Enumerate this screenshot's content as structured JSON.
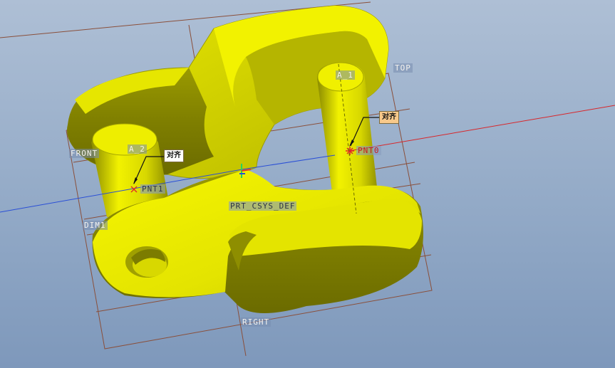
{
  "viewport": {
    "background_top": "#aebfd5",
    "background_bottom": "#7e98bb",
    "part_color": "#ecec00",
    "datum_color": "#8a4f3a"
  },
  "labels": {
    "front": "FRONT",
    "top": "TOP",
    "right": "RIGHT",
    "axis_a1": "A_1",
    "axis_a2": "A_2",
    "point_0": "PNT0",
    "point_1": "PNT1",
    "coord_sys": "PRT_CSYS_DEF",
    "dimension": "DIM1"
  },
  "constraints": {
    "align_tag_1": "对齐",
    "align_tag_2": "对齐"
  }
}
